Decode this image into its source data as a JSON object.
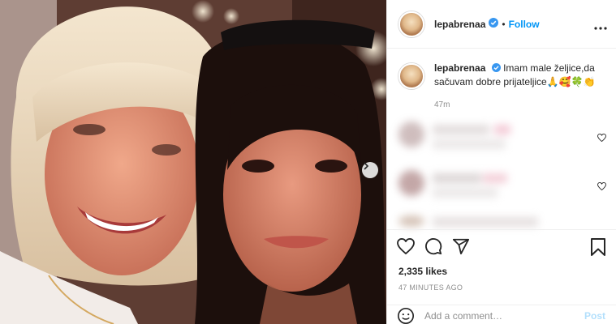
{
  "header": {
    "username": "lepabrenaa",
    "separator": "•",
    "follow_label": "Follow"
  },
  "caption": {
    "username": "lepabrenaa",
    "text": "Imam male željice,da sačuvam dobre prijateljice🙏🥰🍀👏",
    "time": "47m"
  },
  "likes": "2,335 likes",
  "post_time": "47 MINUTES AGO",
  "comment": {
    "placeholder": "Add a comment…",
    "post_label": "Post"
  },
  "icons": {
    "verified": "verified-badge-icon",
    "more": "more-options-icon",
    "like": "heart-icon",
    "comment": "comment-icon",
    "share": "paper-plane-icon",
    "save": "bookmark-icon",
    "emoji": "smiley-icon",
    "next": "chevron-right-icon"
  },
  "colors": {
    "accent": "#0095f6",
    "verified": "#3897f0",
    "post_disabled": "#b2dffc",
    "muted": "#8e8e8e"
  }
}
